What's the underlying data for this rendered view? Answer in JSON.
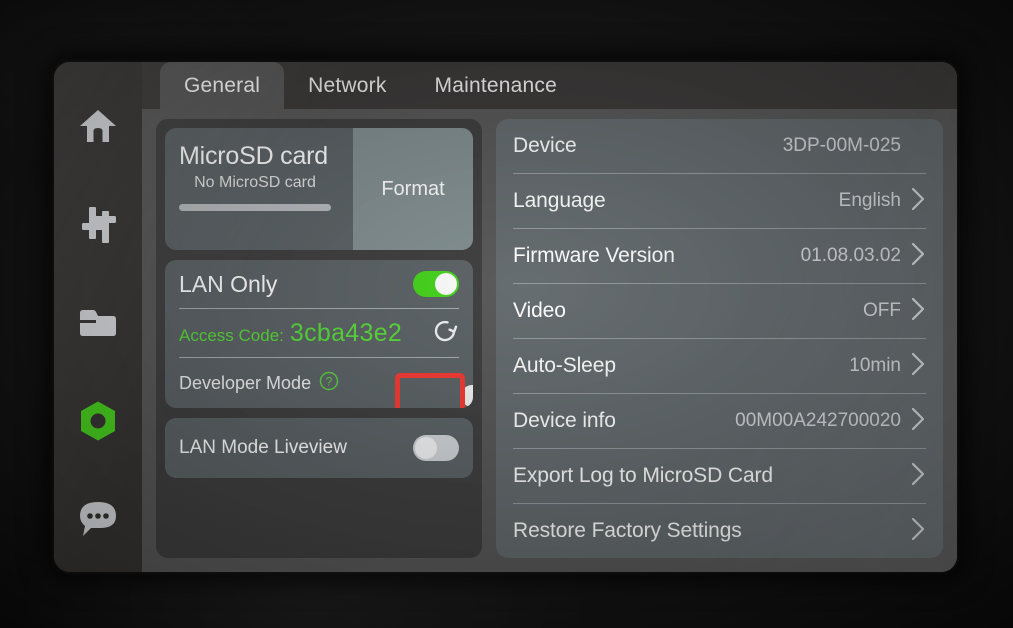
{
  "sidebar": {
    "items": [
      {
        "name": "home",
        "icon": "home-icon",
        "active": false
      },
      {
        "name": "tune",
        "icon": "sliders-icon",
        "active": false
      },
      {
        "name": "files",
        "icon": "folder-icon",
        "active": false
      },
      {
        "name": "settings",
        "icon": "hex-nut-icon",
        "active": true
      },
      {
        "name": "messages",
        "icon": "chat-bubble-icon",
        "active": false
      }
    ],
    "active_color": "#46d41c"
  },
  "tabs": [
    {
      "label": "General",
      "active": true
    },
    {
      "label": "Network",
      "active": false
    },
    {
      "label": "Maintenance",
      "active": false
    }
  ],
  "left": {
    "sd_card": {
      "title": "MicroSD card",
      "subtitle": "No MicroSD card",
      "progress_percent": 0,
      "format_label": "Format"
    },
    "lan": {
      "title": "LAN Only",
      "toggle_state": "on",
      "access_code_label": "Access Code:",
      "access_code_value": "3cba43e2",
      "refresh_icon": "refresh-icon",
      "access_code_color": "#59dc3a",
      "developer_mode_label": "Developer Mode",
      "developer_mode_help_icon": "question-circle-icon",
      "developer_mode_toggle_state": "off",
      "developer_mode_highlight_color": "#f43b33"
    },
    "liveview": {
      "label": "LAN Mode Liveview",
      "toggle_state": "off"
    }
  },
  "settings_list": [
    {
      "label": "Device",
      "value": "3DP-00M-025",
      "chevron": false
    },
    {
      "label": "Language",
      "value": "English",
      "chevron": true
    },
    {
      "label": "Firmware Version",
      "value": "01.08.03.02",
      "chevron": true
    },
    {
      "label": "Video",
      "value": "OFF",
      "chevron": true
    },
    {
      "label": "Auto-Sleep",
      "value": "10min",
      "chevron": true
    },
    {
      "label": "Device info",
      "value": "00M00A242700020",
      "chevron": true
    },
    {
      "label": "Export Log to MicroSD Card",
      "value": "",
      "chevron": true
    },
    {
      "label": "Restore Factory Settings",
      "value": "",
      "chevron": true
    }
  ]
}
